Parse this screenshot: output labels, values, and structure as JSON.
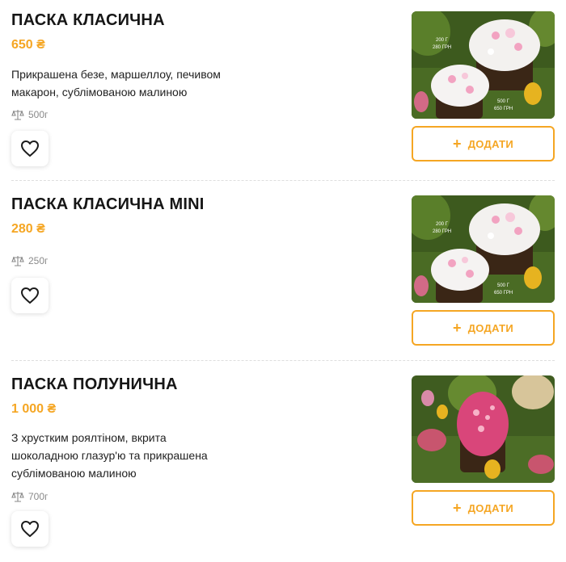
{
  "products": [
    {
      "title": "ПАСКА КЛАСИЧНА",
      "price": "650 ₴",
      "desc_lines": [
        "Прикрашена безе, маршеллоу, печивом",
        "макарон, сублімованою малиною"
      ],
      "weight": "500г",
      "add_label": "ДОДАТИ",
      "photo_labels": [
        "200 Г",
        "280 ГРН",
        "500 Г",
        "650 ГРН"
      ]
    },
    {
      "title": "ПАСКА КЛАСИЧНА MINI",
      "price": "280 ₴",
      "desc_lines": [],
      "weight": "250г",
      "add_label": "ДОДАТИ",
      "photo_labels": [
        "200 Г",
        "280 ГРН",
        "500 Г",
        "650 ГРН"
      ]
    },
    {
      "title": "ПАСКА ПОЛУНИЧНА",
      "price": "1 000 ₴",
      "desc_lines": [
        "З хрустким роялтіном, вкрита",
        "шоколадною глазур'ю та прикрашена",
        "сублімованою малиною"
      ],
      "weight": "700г",
      "add_label": "ДОДАТИ",
      "photo_labels": []
    }
  ],
  "icons": {
    "weight": "scales-icon",
    "favorite": "heart-icon",
    "add": "plus-icon"
  },
  "colors": {
    "accent": "#f5a623",
    "text": "#161616",
    "muted": "#8a8a8a"
  }
}
